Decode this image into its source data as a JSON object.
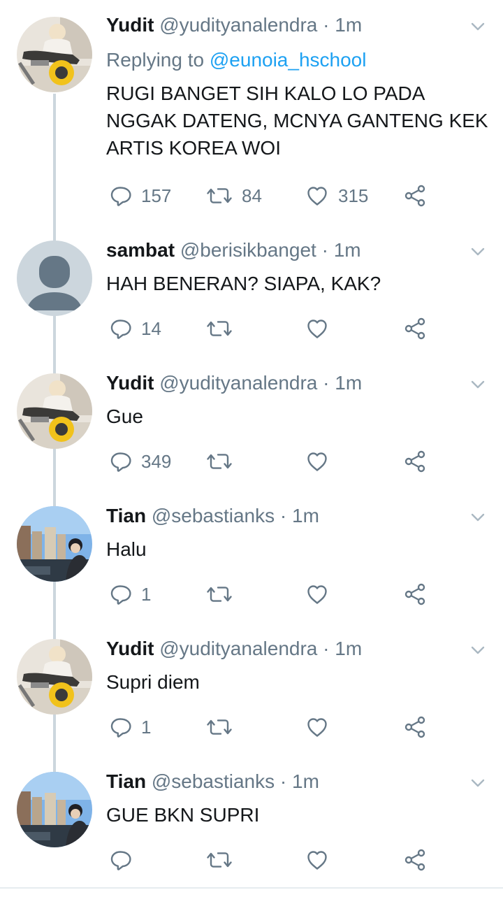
{
  "colors": {
    "name": "#14171a",
    "muted": "#657786",
    "link": "#1da1f2",
    "thread": "#ccd6dd",
    "icon": "#657786"
  },
  "tweets": [
    {
      "name": "Yudit",
      "handle": "@yudityanalendra",
      "dot": "·",
      "time": "1m",
      "reply_prefix": "Replying to",
      "reply_handle": "@eunoia_hschool",
      "text": "RUGI BANGET SIH KALO LO PADA NGGAK DATENG, MCNYA GANTENG KEK ARTIS KOREA WOI",
      "replies": "157",
      "retweets": "84",
      "likes": "315",
      "avatar": "motorcycle-photo-avatar"
    },
    {
      "name": "sambat",
      "handle": "@berisikbanget",
      "dot": "·",
      "time": "1m",
      "text": "HAH BENERAN? SIAPA, KAK?",
      "replies": "14",
      "retweets": "",
      "likes": "",
      "avatar": "default-user-avatar"
    },
    {
      "name": "Yudit",
      "handle": "@yudityanalendra",
      "dot": "·",
      "time": "1m",
      "text": "Gue",
      "replies": "349",
      "retweets": "",
      "likes": "",
      "avatar": "motorcycle-photo-avatar"
    },
    {
      "name": "Tian",
      "handle": "@sebastianks",
      "dot": "·",
      "time": "1m",
      "text": "Halu",
      "replies": "1",
      "retweets": "",
      "likes": "",
      "avatar": "city-photo-avatar"
    },
    {
      "name": "Yudit",
      "handle": "@yudityanalendra",
      "dot": "·",
      "time": "1m",
      "text": "Supri diem",
      "replies": "1",
      "retweets": "",
      "likes": "",
      "avatar": "motorcycle-photo-avatar"
    },
    {
      "name": "Tian",
      "handle": "@sebastianks",
      "dot": "·",
      "time": "1m",
      "text": "GUE BKN SUPRI",
      "replies": "",
      "retweets": "",
      "likes": "",
      "avatar": "city-photo-avatar"
    }
  ]
}
